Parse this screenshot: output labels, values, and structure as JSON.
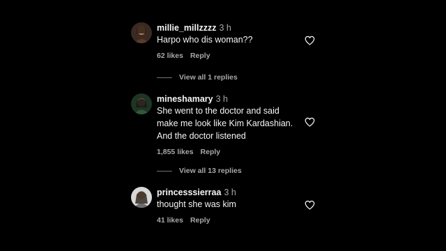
{
  "comments": [
    {
      "username": "millie_millzzzz",
      "time": "3 h",
      "text": "Harpo who dis woman??",
      "likes": "62 likes",
      "reply_label": "Reply",
      "view_replies": "View all 1 replies",
      "avatar_color": "#5a3b2b"
    },
    {
      "username": "mineshamary",
      "time": "3 h",
      "text": "She went to the doctor and said\nmake me look like Kim Kardashian.\nAnd the doctor listened",
      "likes": "1,855 likes",
      "reply_label": "Reply",
      "view_replies": "View all 13 replies",
      "avatar_color": "#2f5a3a"
    },
    {
      "username": "princesssierraa",
      "time": "3 h",
      "text": "thought she was kim",
      "likes": "41 likes",
      "reply_label": "Reply",
      "avatar_color": "#6b6b6b"
    }
  ],
  "colors": {
    "background": "#000000",
    "primary_text": "#f5f5f5",
    "secondary_text": "#a8a8a8"
  },
  "icons": {
    "like": "heart-outline-icon"
  }
}
